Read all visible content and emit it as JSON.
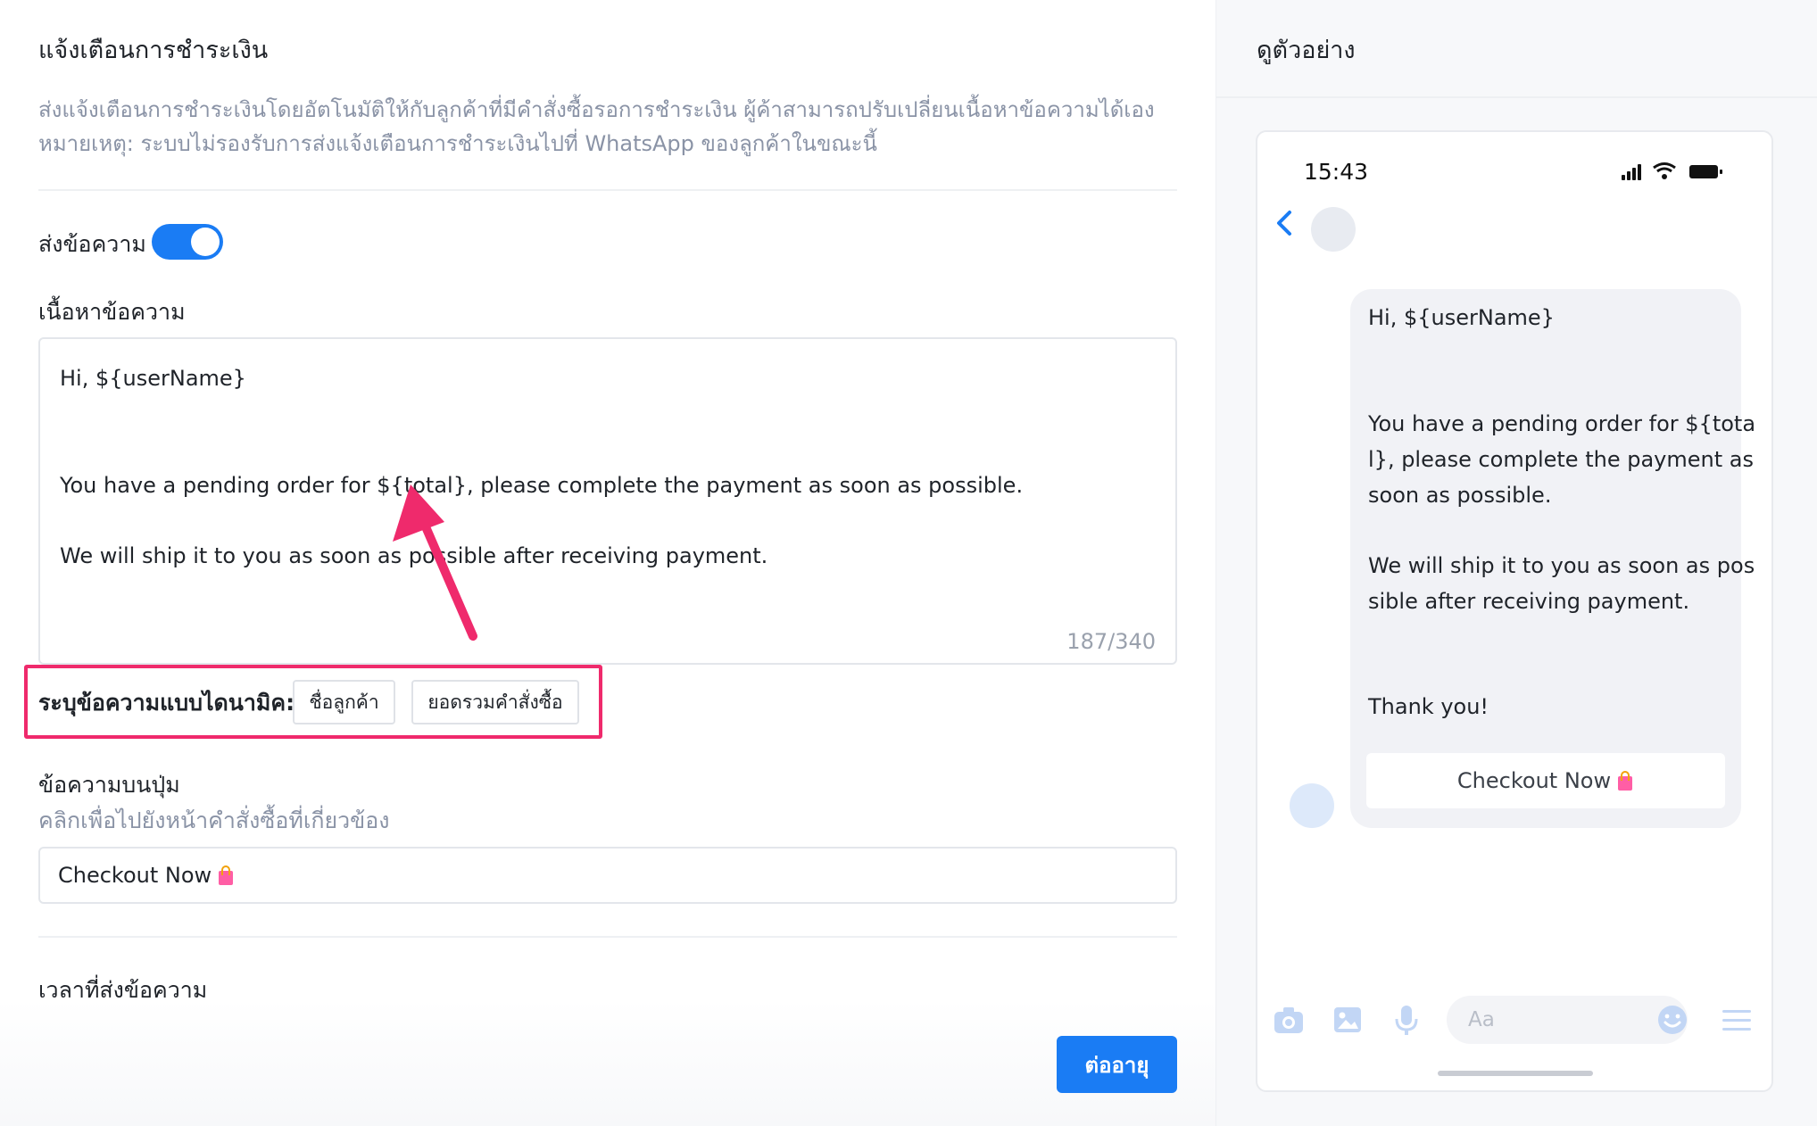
{
  "settings": {
    "title": "แจ้งเตือนการชำระเงิน",
    "description_line1": "ส่งแจ้งเตือนการชำระเงินโดยอัตโนมัติให้กับลูกค้าที่มีคำสั่งซื้อรอการชำระเงิน ผู้ค้าสามารถปรับเปลี่ยนเนื้อหาข้อความได้เอง",
    "description_line2": "หมายเหตุ: ระบบไม่รองรับการส่งแจ้งเตือนการชำระเงินไปที่ WhatsApp ของลูกค้าในขณะนี้",
    "send_message_label": "ส่งข้อความ",
    "send_message_enabled": true,
    "content_label": "เนื้อหาข้อความ",
    "message_lines": [
      "Hi, ${userName}",
      "",
      "",
      "You have a pending order for ${total}, please complete the payment as soon as possible.",
      "",
      "We will ship it to you as soon as possible after receiving payment."
    ],
    "char_counter": "187/340",
    "dynamic_label": "ระบุข้อความแบบไดนามิค:",
    "dynamic_chips": [
      "ชื่อลูกค้า",
      "ยอดรวมคำสั่งซื้อ"
    ],
    "button_text_label": "ข้อความบนปุ่ม",
    "button_text_sub": "คลิกเพื่อไปยังหน้าคำสั่งซื้อที่เกี่ยวข้อง",
    "button_text_value": "Checkout Now",
    "send_time_label": "เวลาที่ส่งข้อความ",
    "continue_button": "ต่ออายุ"
  },
  "preview": {
    "title": "ดูตัวอย่าง",
    "status_time": "15:43",
    "bubble_lines": [
      "Hi, ${userName}",
      "",
      "",
      "You have a pending order for ${tota",
      "l}, please complete the payment as",
      "soon as possible.",
      "",
      "We will ship it to you as soon as pos",
      "sible after receiving payment.",
      "",
      "",
      "Thank you!"
    ],
    "cta_label": "Checkout Now",
    "composer_placeholder": "Aa"
  },
  "colors": {
    "accent": "#1a7cf4",
    "highlight": "#ef2a6c",
    "muted_text": "#8a93a6"
  },
  "icons": [
    "arrow-annotation-icon",
    "back-chevron-icon",
    "signal-icon",
    "wifi-icon",
    "battery-icon",
    "camera-icon",
    "image-icon",
    "microphone-icon",
    "emoji-icon",
    "menu-icon",
    "shopping-bag-icon"
  ]
}
